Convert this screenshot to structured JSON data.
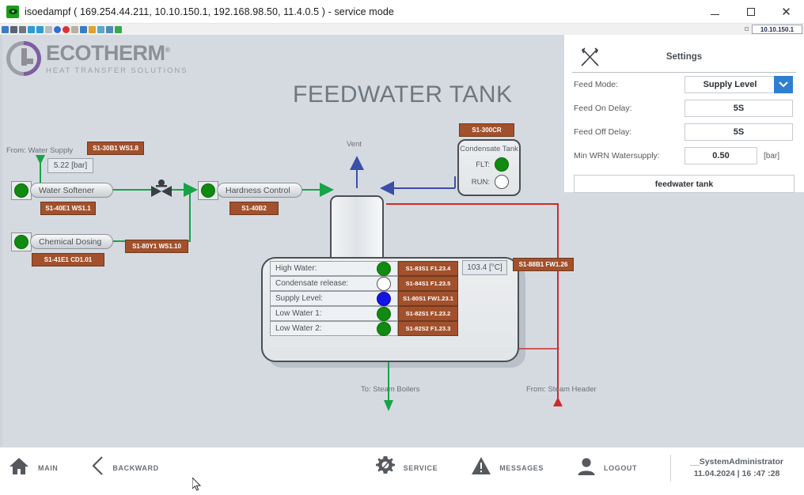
{
  "window": {
    "title": "isoedampf ( 169.254.44.211, 10.10.150.1, 192.168.98.50, 11.4.0.5 ) - service mode",
    "app_icon": "eye-icon",
    "minimize": "minimize-icon",
    "maximize": "maximize-icon",
    "close": "close-icon",
    "ip_badge": "10.10.150.1",
    "toolbar_icons": [
      {
        "name": "back-icon",
        "color": "#3b7dc4"
      },
      {
        "name": "shrink-icon",
        "color": "#5a6570"
      },
      {
        "name": "settings-gear-icon",
        "color": "#6f7880"
      },
      {
        "name": "refresh-icon",
        "color": "#2f9ad6"
      },
      {
        "name": "windows-grid-icon",
        "color": "#2f9ad6"
      },
      {
        "name": "save-disk-icon",
        "color": "#b6bcc2"
      },
      {
        "name": "info-icon",
        "color": "#2f6fd6"
      },
      {
        "name": "stop-record-icon",
        "color": "#e03030"
      },
      {
        "name": "thermometer-icon",
        "color": "#b8b0a0"
      },
      {
        "name": "monitor-icon",
        "color": "#3b7dc4"
      },
      {
        "name": "panel-icon",
        "color": "#e0a32a"
      },
      {
        "name": "network-icon",
        "color": "#5aa7c8"
      },
      {
        "name": "sync-icon",
        "color": "#4e8ab5"
      },
      {
        "name": "chat-icon",
        "color": "#3aa84a"
      }
    ]
  },
  "brand": {
    "name": "ECOTHERM",
    "trademark": "®",
    "tagline": "HEAT TRANSFER SOLUTIONS"
  },
  "page": {
    "title": "FEEDWATER TANK"
  },
  "settings": {
    "title": "Settings",
    "icon": "tools-crossed-icon",
    "rows": [
      {
        "label": "Feed Mode:",
        "value": "Supply Level",
        "type": "select",
        "caret": "chevron-down-icon"
      },
      {
        "label": "Feed On Delay:",
        "value": "5S",
        "type": "text"
      },
      {
        "label": "Feed Off Delay:",
        "value": "5S",
        "type": "text"
      },
      {
        "label": "Min WRN Watersupply:",
        "value": "0.50",
        "type": "text",
        "unit": "[bar]"
      }
    ],
    "button_label": "feedwater tank",
    "accent_color": "#2f7fd1"
  },
  "diagram": {
    "source_label": "From: Water Supply",
    "pressure_readout": "5.22 [bar]",
    "vent_label": "Vent",
    "to_boilers_label": "To: Steam Boilers",
    "from_header_label": "From: Steam Header",
    "devices": [
      {
        "name": "water-softener",
        "label": "Water Softener",
        "lamp": "green",
        "tag": "S1-40E1 WS1.1"
      },
      {
        "name": "chemical-dosing",
        "label": "Chemical Dosing",
        "lamp": "green",
        "tag": "S1-41E1 CD1.01"
      },
      {
        "name": "hardness-control",
        "label": "Hardness Control",
        "lamp": "green",
        "tag": "S1-40B2"
      }
    ],
    "supply_tag": "S1-30B1 WS1.8",
    "valve_tag": "S1-80Y1 WS1.10",
    "condensate": {
      "tag": "S1-300CR",
      "title": "Condensate Tank",
      "rows": [
        {
          "label": "FLT:",
          "lamp": "green"
        },
        {
          "label": "RUN:",
          "lamp": "white"
        }
      ]
    },
    "indicators": [
      {
        "label": "High Water:",
        "lamp": "green",
        "tag": "S1-83S1 F1.23.4"
      },
      {
        "label": "Condensate release:",
        "lamp": "white",
        "tag": "S1-84S1 F1.23.5"
      },
      {
        "label": "Supply Level:",
        "lamp": "blue",
        "tag": "S1-80S1 FW1.23.1"
      },
      {
        "label": "Low Water 1:",
        "lamp": "green",
        "tag": "S1-82S1 F1.23.2"
      },
      {
        "label": "Low Water 2:",
        "lamp": "green",
        "tag": "S1-82S2 F1.23.3"
      }
    ],
    "temperature_readout": "103.4 [°C]",
    "feedwater_tag": "S1-88B1 FW1.26",
    "pipe_colors": {
      "water": "#17a349",
      "steam": "#cf2b2b",
      "condensate": "#3b4fa8"
    }
  },
  "bottombar": {
    "items": [
      {
        "name": "home",
        "label": "MAIN",
        "icon": "home-icon"
      },
      {
        "name": "backward",
        "label": "BACKWARD",
        "icon": "chevron-left-icon"
      },
      {
        "name": "service",
        "label": "SERVICE",
        "icon": "gear-icon"
      },
      {
        "name": "messages",
        "label": "MESSAGES",
        "icon": "warning-triangle-icon"
      },
      {
        "name": "logout",
        "label": "LOGOUT",
        "icon": "user-icon"
      }
    ],
    "user": "__SystemAdministrator",
    "datetime": "11.04.2024 | 16 :47 :28"
  }
}
